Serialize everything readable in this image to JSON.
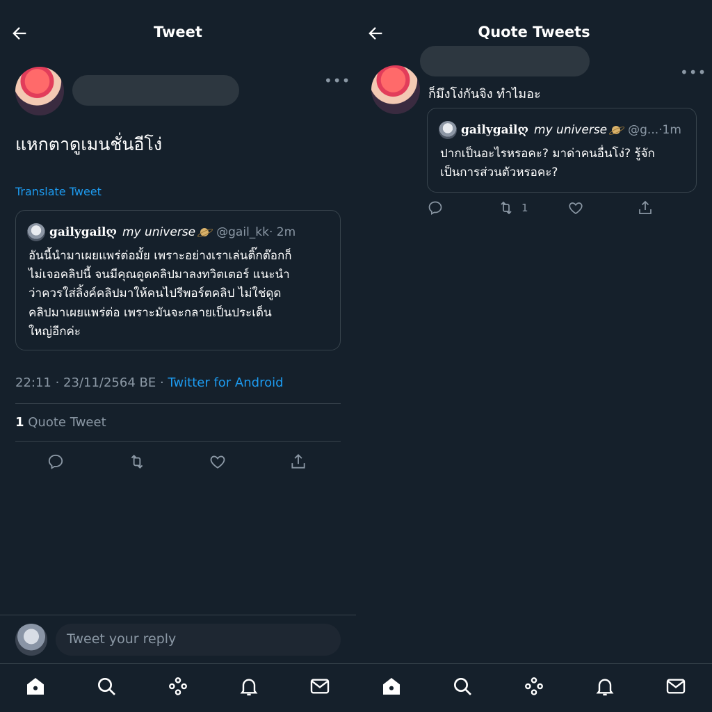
{
  "left": {
    "header": {
      "title": "Tweet"
    },
    "tweet": {
      "text": "แหกตาดูเมนชั่นอีโง่",
      "translate_label": "Translate Tweet",
      "timestamp": "22:11 · 23/11/2564 BE · ",
      "source": "Twitter for Android"
    },
    "quoted": {
      "name": "gailygailღ",
      "name_italic": "my universe",
      "handle": "@gail_kk",
      "time": " · 2m",
      "lines": [
        "อันนี้นำมาเผยแพร่ต่อมั้ย เพราะอย่างเราเล่นติ๊กต๊อกก็",
        "ไม่เจอคลิปนี้ จนมีคุณดูดคลิปมาลงทวิตเตอร์ แนะนำ",
        "ว่าควรใส่ลิ้งค์คลิปมาให้คนไปรีพอร์ตคลิป ไม่ใช่ดูด",
        "คลิปมาเผยแพร่ต่อ เพราะมันจะกลายเป็นประเด็น",
        "ใหญ่อีกค่ะ"
      ]
    },
    "quote_count": {
      "number": "1",
      "label": " Quote Tweet"
    },
    "reply": {
      "placeholder": "Tweet your reply"
    }
  },
  "right": {
    "header": {
      "title": "Quote Tweets"
    },
    "tweet": {
      "text": "ก็มึงโง่กันจิง ทำไมอะ",
      "retweet_count": "1"
    },
    "quoted": {
      "name": "gailygailღ",
      "name_italic": "my universe",
      "handle": "@g...",
      "time": " ·1m",
      "lines": [
        "ปากเป็นอะไรหรอคะ? มาด่าคนอื่นโง่? รู้จัก",
        "เป็นการส่วนตัวหรอคะ?"
      ]
    }
  },
  "icons": {
    "back": "arrow-left-icon",
    "more": "more-dots-icon",
    "reply": "reply-bubble-icon",
    "retweet": "retweet-icon",
    "like": "heart-icon",
    "share": "share-icon",
    "nav": [
      "home-icon",
      "search-icon",
      "spaces-icon",
      "notifications-icon",
      "messages-icon"
    ]
  },
  "colors": {
    "background": "#15202b",
    "accent": "#1d9bf0",
    "muted": "#8b98a5",
    "border": "#38444d"
  }
}
